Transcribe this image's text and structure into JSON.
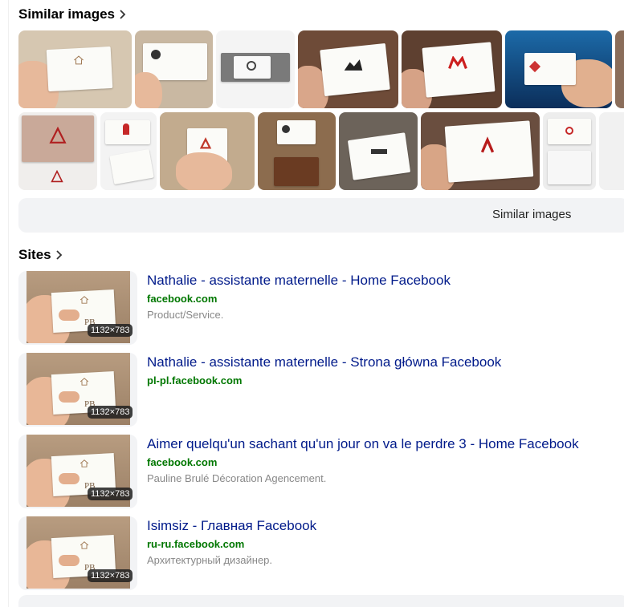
{
  "similar": {
    "title": "Similar images",
    "button_label": "Similar images"
  },
  "sites": {
    "title": "Sites",
    "items": [
      {
        "title": "Nathalie - assistante maternelle - Home Facebook",
        "domain": "facebook.com",
        "description": "Product/Service.",
        "dimensions": "1132×783"
      },
      {
        "title": "Nathalie - assistante maternelle - Strona główna Facebook",
        "domain": "pl-pl.facebook.com",
        "description": "",
        "dimensions": "1132×783"
      },
      {
        "title": "Aimer quelqu'un sachant qu'un jour on va le perdre 3 - Home Facebook",
        "domain": "facebook.com",
        "description": "Pauline Brulé Décoration Agencement.",
        "dimensions": "1132×783"
      },
      {
        "title": "Isimsiz - Главная Facebook",
        "domain": "ru-ru.facebook.com",
        "description": "Архитектурный дизайнер.",
        "dimensions": "1132×783"
      }
    ]
  },
  "icons": {
    "chevron": "chevron-right-icon"
  },
  "colors": {
    "link": "#001a8a",
    "domain": "#007700",
    "muted": "#888888",
    "button_bg": "#f2f3f5"
  }
}
